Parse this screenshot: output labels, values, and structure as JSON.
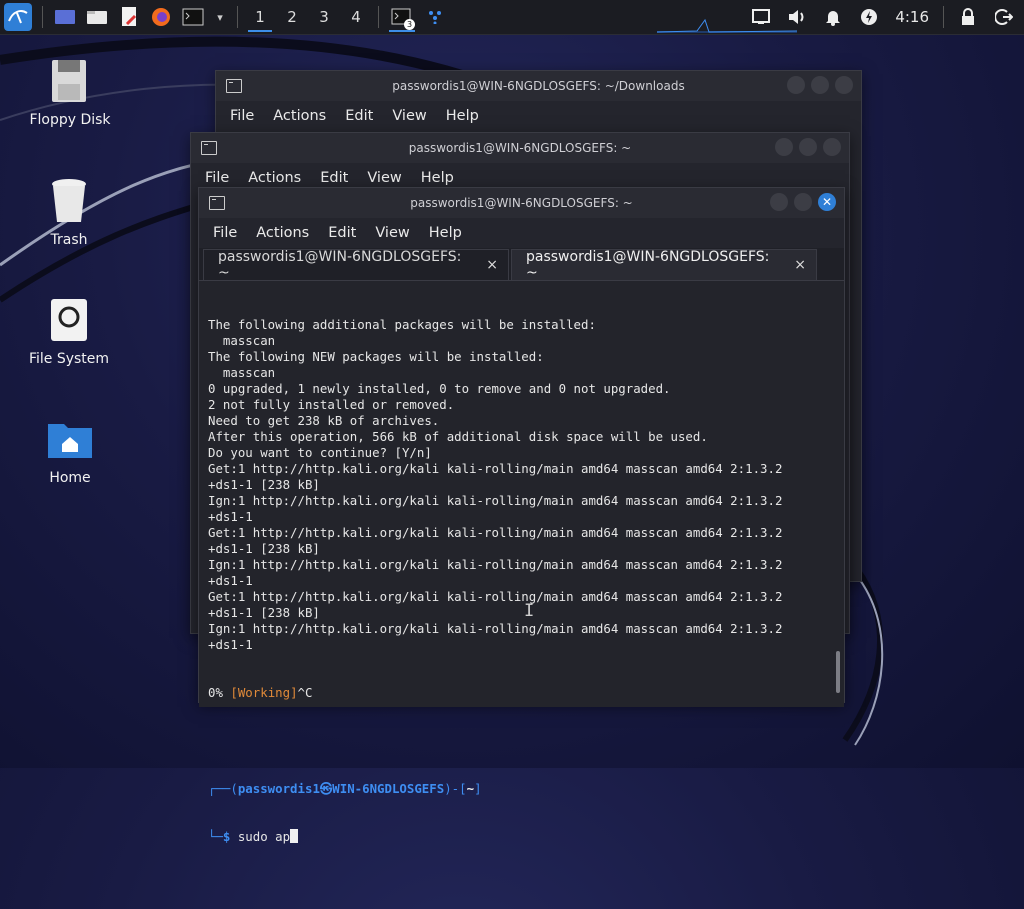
{
  "taskbar": {
    "workspaces": [
      "1",
      "2",
      "3",
      "4"
    ],
    "terminal_badge": "3",
    "clock": "4:16"
  },
  "desktop": {
    "icons": [
      {
        "label": "Floppy Disk"
      },
      {
        "label": "Trash"
      },
      {
        "label": "File System"
      },
      {
        "label": "Home"
      }
    ]
  },
  "windows": {
    "back": {
      "title": "passwordis1@WIN-6NGDLOSGEFS: ~/Downloads",
      "menu": [
        "File",
        "Actions",
        "Edit",
        "View",
        "Help"
      ]
    },
    "middle": {
      "title": "passwordis1@WIN-6NGDLOSGEFS: ~",
      "menu": [
        "File",
        "Actions",
        "Edit",
        "View",
        "Help"
      ]
    },
    "front": {
      "title": "passwordis1@WIN-6NGDLOSGEFS: ~",
      "menu": [
        "File",
        "Actions",
        "Edit",
        "View",
        "Help"
      ],
      "tabs": [
        {
          "label": "passwordis1@WIN-6NGDLOSGEFS: ~",
          "close": "×"
        },
        {
          "label": "passwordis1@WIN-6NGDLOSGEFS: ~",
          "close": "×"
        }
      ],
      "terminal": {
        "lines": [
          "The following additional packages will be installed:",
          "  masscan",
          "The following NEW packages will be installed:",
          "  masscan",
          "0 upgraded, 1 newly installed, 0 to remove and 0 not upgraded.",
          "2 not fully installed or removed.",
          "Need to get 238 kB of archives.",
          "After this operation, 566 kB of additional disk space will be used.",
          "Do you want to continue? [Y/n]",
          "Get:1 http://http.kali.org/kali kali-rolling/main amd64 masscan amd64 2:1.3.2",
          "+ds1-1 [238 kB]",
          "Ign:1 http://http.kali.org/kali kali-rolling/main amd64 masscan amd64 2:1.3.2",
          "+ds1-1",
          "Get:1 http://http.kali.org/kali kali-rolling/main amd64 masscan amd64 2:1.3.2",
          "+ds1-1 [238 kB]",
          "Ign:1 http://http.kali.org/kali kali-rolling/main amd64 masscan amd64 2:1.3.2",
          "+ds1-1",
          "Get:1 http://http.kali.org/kali kali-rolling/main amd64 masscan amd64 2:1.3.2",
          "+ds1-1 [238 kB]",
          "Ign:1 http://http.kali.org/kali kali-rolling/main amd64 masscan amd64 2:1.3.2",
          "+ds1-1"
        ],
        "working_prefix": "0% ",
        "working_label": "[Working]",
        "working_suffix": "^C",
        "prompt_box_start": "┌──(",
        "prompt_user": "passwordis1㉿WIN-6NGDLOSGEFS",
        "prompt_box_mid": ")-[",
        "prompt_dir": "~",
        "prompt_box_end": "]",
        "prompt_line2_start": "└─",
        "prompt_dollar": "$ ",
        "command": "sudo ap"
      }
    }
  },
  "colors": {
    "accent": "#2f7fd6",
    "prompt_blue": "#3e8ef2",
    "working_orange": "#e08a39"
  }
}
